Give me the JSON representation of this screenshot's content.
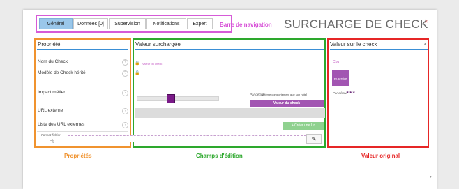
{
  "tabs": [
    "Général",
    "Données [0]",
    "Supervision",
    "Notifications",
    "Expert"
  ],
  "nav_annotation": "Barre de navigation",
  "title": "SURCHARGE DE CHECK",
  "close": "×",
  "columns": {
    "left": "Propriété",
    "middle": "Valeur surchargée",
    "right": "Valeur sur le check"
  },
  "properties": {
    "check_name": "Nom du Check",
    "inherited_model": "Modèle de Check hérité",
    "business_impact": "Impact métier",
    "external_url": "URL externe",
    "external_urls_list": "Liste des URL externes",
    "format_file": "Format fichier",
    "cfg": "Cfg"
  },
  "middle": {
    "check_value": "Valeur du check",
    "default_label": "Par défaut",
    "default_value": "[Même comportement que son hôte]",
    "check_value_button": "Valeur du check",
    "create_url_button": "+ Créer une Url"
  },
  "right": {
    "check_value": "Cpu",
    "badge": "en-service",
    "default_label": "Par défaut",
    "stars": "★★★"
  },
  "annotations": {
    "left": "Propriétés",
    "middle": "Champs d'édition",
    "right": "Valeur original"
  },
  "colors": {
    "tab_active": "#9ac7ea",
    "nav_highlight": "#d65bd8",
    "properties_highlight": "#f0932f",
    "edit_highlight": "#2da82d",
    "original_highlight": "#e62626",
    "accent_purple": "#a255b2",
    "create_button": "#8fd18f"
  }
}
